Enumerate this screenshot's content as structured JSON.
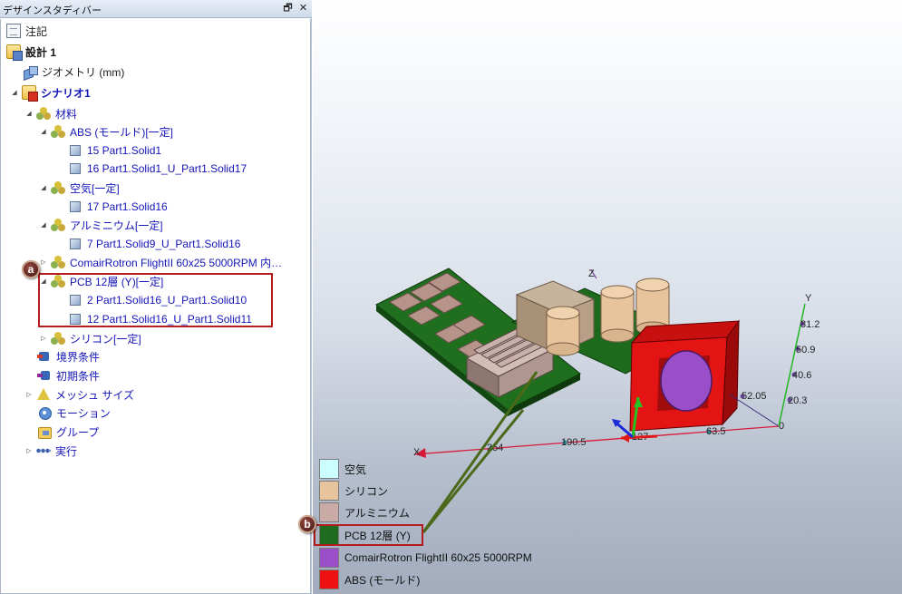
{
  "panel": {
    "title": "デザインスタディバー",
    "float_glyph": "🗗",
    "close_glyph": "✕"
  },
  "tree": {
    "note": "注記",
    "design": "設計 1",
    "geometry": "ジオメトリ (mm)",
    "scenario": "シナリオ1",
    "materials": "材料",
    "abs": "ABS (モールド)[一定]",
    "abs_parts": [
      "15 Part1.Solid1",
      "16 Part1.Solid1_U_Part1.Solid17"
    ],
    "air": "空気[一定]",
    "air_parts": [
      "17 Part1.Solid16"
    ],
    "aluminum": "アルミニウム[一定]",
    "aluminum_parts": [
      "7 Part1.Solid9_U_Part1.Solid16"
    ],
    "fan": "ComairRotron FlightII 60x25 5000RPM 内…",
    "pcb": "PCB 12層 (Y)[一定]",
    "pcb_parts": [
      "2 Part1.Solid16_U_Part1.Solid10",
      "12 Part1.Solid16_U_Part1.Solid11"
    ],
    "silicon": "シリコン[一定]",
    "boundary": "境界条件",
    "initial": "初期条件",
    "mesh": "メッシュ サイズ",
    "motion": "モーション",
    "group": "グループ",
    "run": "実行"
  },
  "callouts": {
    "a": "a",
    "b": "b"
  },
  "axes": {
    "x_name": "X",
    "y_name": "Y",
    "z_name": "Z",
    "x_ticks": [
      "254",
      "190.5",
      "127",
      "63.5",
      "0"
    ],
    "y_ticks": [
      "20.3",
      "40.6",
      "50.9",
      "81.2"
    ],
    "z_tick": "52.05"
  },
  "legend": [
    {
      "label": "空気",
      "color": "#ccffff"
    },
    {
      "label": "シリコン",
      "color": "#e8c49c"
    },
    {
      "label": "アルミニウム",
      "color": "#c9aaa4"
    },
    {
      "label": "PCB 12層 (Y)",
      "color": "#1f6b1f"
    },
    {
      "label": "ComairRotron FlightII 60x25 5000RPM",
      "color": "#9a4ec8"
    },
    {
      "label": "ABS (モールド)",
      "color": "#ee1111"
    }
  ]
}
